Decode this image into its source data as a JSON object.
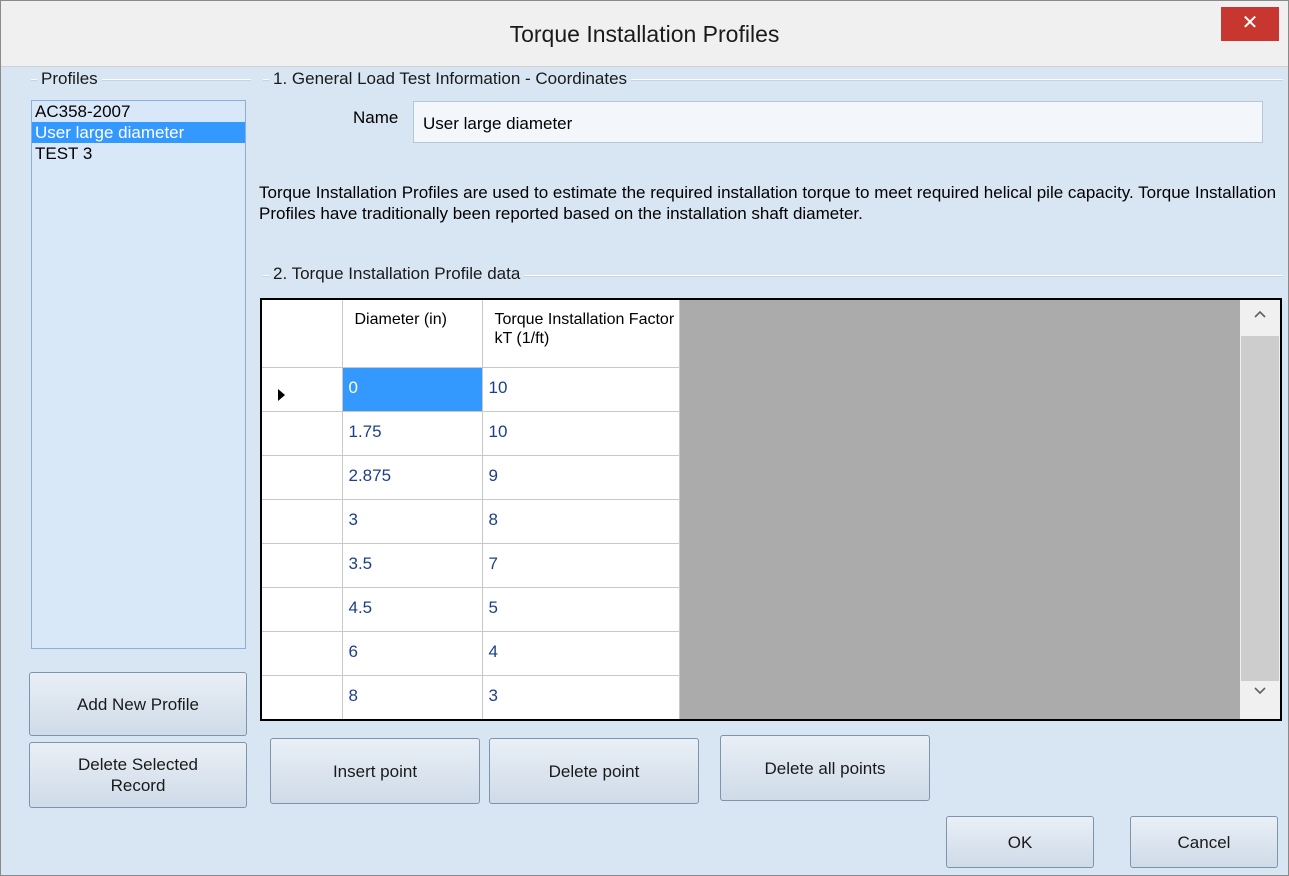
{
  "window": {
    "title": "Torque Installation Profiles",
    "close_glyph": "✕"
  },
  "profiles": {
    "group_label": "Profiles",
    "items": [
      {
        "label": "AC358-2007",
        "selected": false
      },
      {
        "label": "User large diameter",
        "selected": true
      },
      {
        "label": "TEST 3",
        "selected": false
      }
    ],
    "add_button": "Add New Profile",
    "delete_button": "Delete Selected Record"
  },
  "general": {
    "group_label": "1. General Load Test Information - Coordinates",
    "name_label": "Name",
    "name_value": "User large diameter",
    "description": "Torque Installation Profiles are used to estimate the required installation torque to meet required helical pile capacity. Torque Installation Profiles have traditionally been reported based on the installation shaft diameter."
  },
  "profile_data": {
    "group_label": "2. Torque Installation Profile data",
    "columns": [
      "Diameter (in)",
      "Torque Installation Factor kT (1/ft)"
    ],
    "rows": [
      [
        "0",
        "10"
      ],
      [
        "1.75",
        "10"
      ],
      [
        "2.875",
        "9"
      ],
      [
        "3",
        "8"
      ],
      [
        "3.5",
        "7"
      ],
      [
        "4.5",
        "5"
      ],
      [
        "6",
        "4"
      ],
      [
        "8",
        "3"
      ]
    ],
    "insert_button": "Insert point",
    "delete_button": "Delete point",
    "delete_all_button": "Delete all points"
  },
  "footer": {
    "ok": "OK",
    "cancel": "Cancel"
  },
  "icons": {
    "scroll_up": "chevron-up-icon",
    "scroll_down": "chevron-down-icon",
    "row_pointer": "current-row-arrow-icon"
  },
  "colors": {
    "selection": "#3399ff",
    "close": "#c7372f",
    "background": "#d8e5f2"
  }
}
